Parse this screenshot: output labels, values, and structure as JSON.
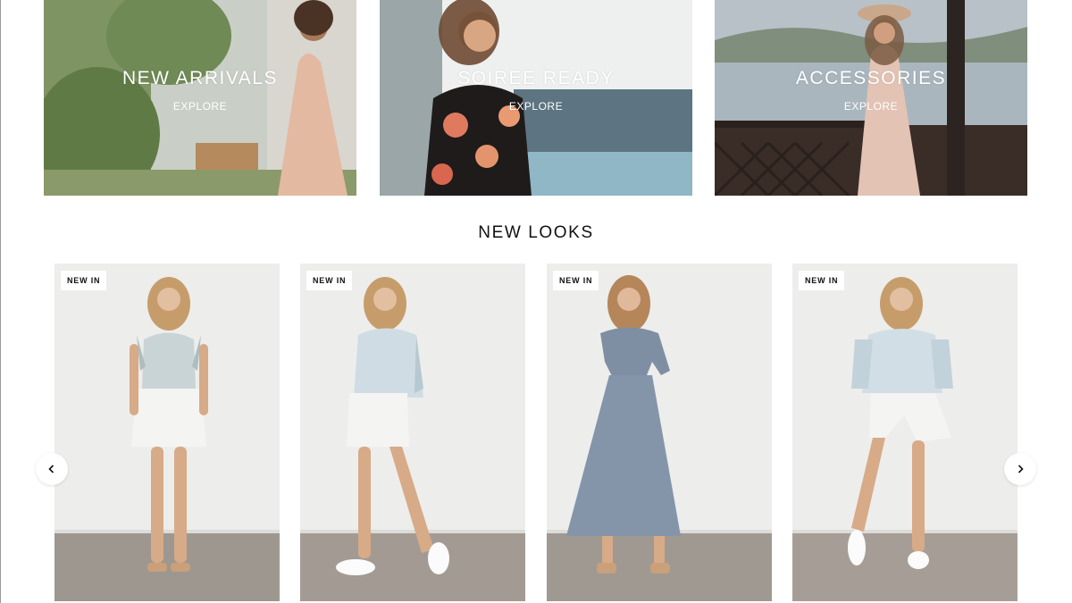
{
  "categories": [
    {
      "title": "NEW ARRIVALS",
      "cta": "EXPLORE"
    },
    {
      "title": "SOIREE READY",
      "cta": "EXPLORE"
    },
    {
      "title": "ACCESSORIES",
      "cta": "EXPLORE"
    }
  ],
  "new_looks": {
    "heading": "NEW LOOKS",
    "products": [
      {
        "badge": "NEW IN"
      },
      {
        "badge": "NEW IN"
      },
      {
        "badge": "NEW IN"
      },
      {
        "badge": "NEW IN"
      }
    ],
    "prev_icon": "chevron-left-icon",
    "next_icon": "chevron-right-icon"
  }
}
